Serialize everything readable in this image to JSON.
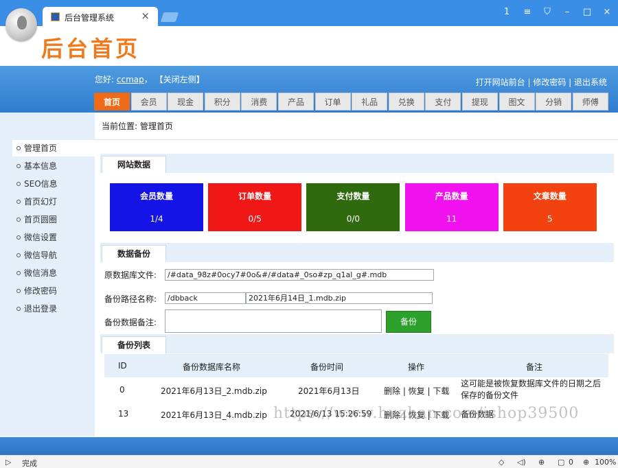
{
  "browser": {
    "tab_title": "后台管理系统",
    "tab_close": "×",
    "controls": [
      "1",
      "≡",
      "⛉",
      "–",
      "□",
      "×"
    ],
    "status": "完成",
    "zoom": "100%",
    "blocked_count": "0"
  },
  "site": {
    "title": "后台首页",
    "greeting_prefix": "您好:",
    "username": "ccmap",
    "greeting_suffix": "，",
    "close_left": "【关闭左侧】",
    "top_links": "打开网站前台 | 修改密码 | 退出系统"
  },
  "menu": [
    "首页",
    "会员",
    "现金",
    "积分",
    "消费",
    "产品",
    "订单",
    "礼品",
    "兑换",
    "支付",
    "提现",
    "图文",
    "分销",
    "师傅"
  ],
  "breadcrumb": "当前位置: 管理首页",
  "sidebar": [
    "管理首页",
    "基本信息",
    "SEO信息",
    "首页幻灯",
    "首页圆圈",
    "微信设置",
    "微信导航",
    "微信消息",
    "修改密码",
    "退出登录"
  ],
  "sections": {
    "site_data": "网站数据",
    "backup": "数据备份",
    "backup_list": "备份列表"
  },
  "stats": [
    {
      "label": "会员数量",
      "value": "1/4",
      "color": "#1414e6"
    },
    {
      "label": "订单数量",
      "value": "0/5",
      "color": "#f01717"
    },
    {
      "label": "支付数量",
      "value": "0/0",
      "color": "#2f6a0e"
    },
    {
      "label": "产品数量",
      "value": "11",
      "color": "#f011ee"
    },
    {
      "label": "文章数量",
      "value": "5",
      "color": "#f2420f"
    }
  ],
  "backup_form": {
    "src_label": "原数据库文件:",
    "src_value": "/#data_98z#0ocy7#0o&#/#data#_0so#zp_q1al_g#.mdb",
    "path_label": "备份路径名称:",
    "path_value": "/dbback",
    "name_value": "2021年6月14日_1.mdb.zip",
    "note_label": "备份数据备注:",
    "note_value": "",
    "button": "备份"
  },
  "table": {
    "headers": [
      "ID",
      "备份数据库名称",
      "备份时间",
      "操作",
      "备注"
    ],
    "rows": [
      {
        "id": "0",
        "name": "2021年6月13日_2.mdb.zip",
        "time": "2021年6月13日",
        "ops": "删除 | 恢复 | 下载",
        "note": "这可能是被恢复数据库文件的日期之后保存的备份文件"
      },
      {
        "id": "13",
        "name": "2021年6月13日_4.mdb.zip",
        "time": "2021/6/13 15:26:59",
        "ops": "删除 | 恢复 | 下载",
        "note": "备份数据"
      }
    ]
  },
  "watermark": "https://www.huzhan.com/ishop39500"
}
